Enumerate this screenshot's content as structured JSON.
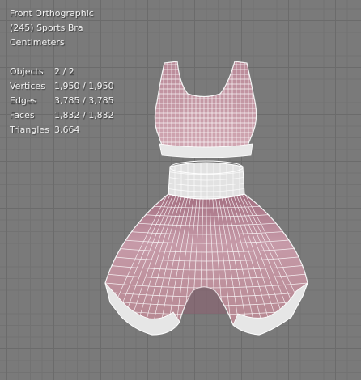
{
  "viewport": {
    "view_name": "Front Orthographic",
    "object_label": "(245) Sports Bra",
    "units": "Centimeters"
  },
  "statistics": [
    {
      "label": "Objects",
      "value": "2 / 2"
    },
    {
      "label": "Vertices",
      "value": "1,950 / 1,950"
    },
    {
      "label": "Edges",
      "value": "3,785 / 3,785"
    },
    {
      "label": "Faces",
      "value": "1,832 / 1,832"
    },
    {
      "label": "Triangles",
      "value": "3,664"
    }
  ],
  "colors": {
    "grid_background": "#7a7a7a",
    "mesh_fill": "#c79aa8",
    "mesh_shadow": "#8e6472",
    "wire": "#ffffff",
    "cuff": "#e9e9e9"
  }
}
